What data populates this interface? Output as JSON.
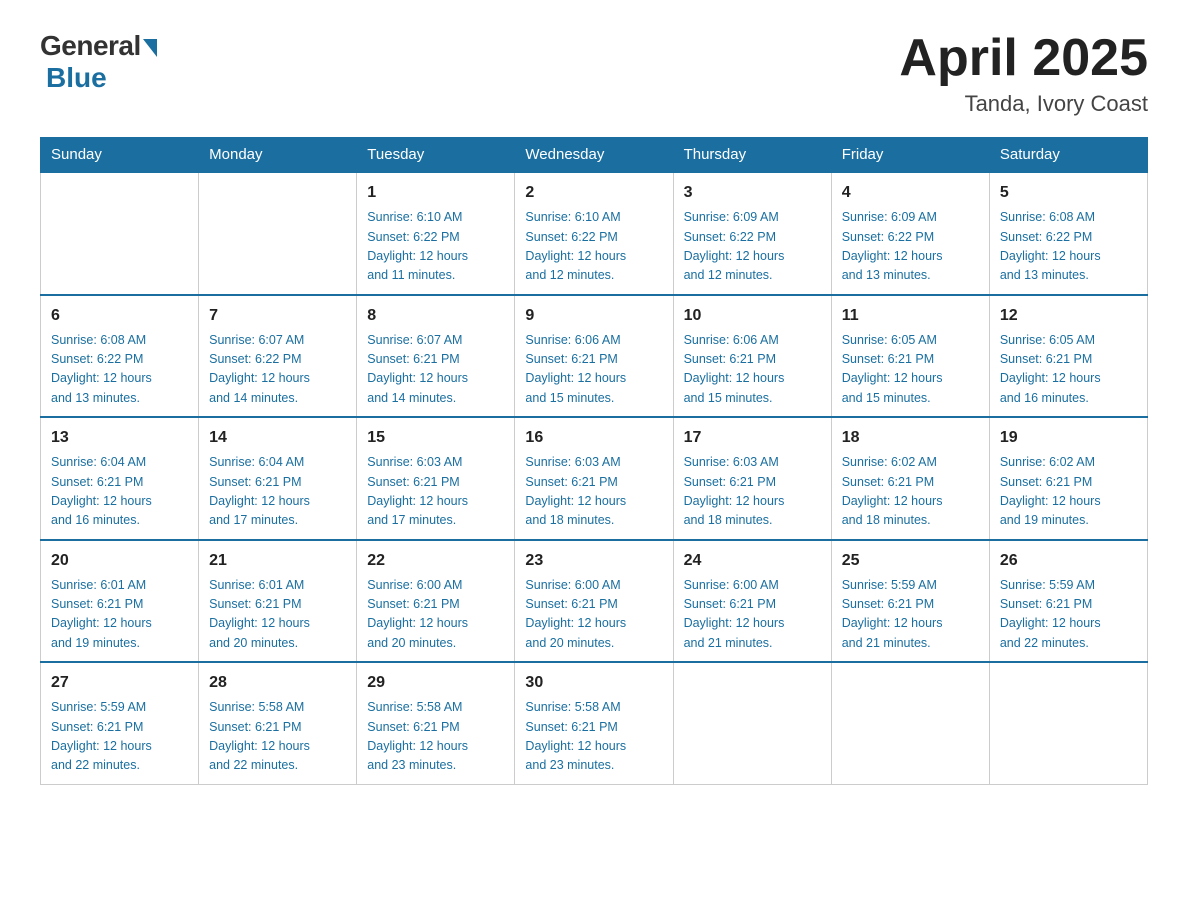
{
  "logo": {
    "general_text": "General",
    "blue_text": "Blue"
  },
  "title": "April 2025",
  "subtitle": "Tanda, Ivory Coast",
  "days_of_week": [
    "Sunday",
    "Monday",
    "Tuesday",
    "Wednesday",
    "Thursday",
    "Friday",
    "Saturday"
  ],
  "weeks": [
    [
      {
        "day": "",
        "info": ""
      },
      {
        "day": "",
        "info": ""
      },
      {
        "day": "1",
        "info": "Sunrise: 6:10 AM\nSunset: 6:22 PM\nDaylight: 12 hours\nand 11 minutes."
      },
      {
        "day": "2",
        "info": "Sunrise: 6:10 AM\nSunset: 6:22 PM\nDaylight: 12 hours\nand 12 minutes."
      },
      {
        "day": "3",
        "info": "Sunrise: 6:09 AM\nSunset: 6:22 PM\nDaylight: 12 hours\nand 12 minutes."
      },
      {
        "day": "4",
        "info": "Sunrise: 6:09 AM\nSunset: 6:22 PM\nDaylight: 12 hours\nand 13 minutes."
      },
      {
        "day": "5",
        "info": "Sunrise: 6:08 AM\nSunset: 6:22 PM\nDaylight: 12 hours\nand 13 minutes."
      }
    ],
    [
      {
        "day": "6",
        "info": "Sunrise: 6:08 AM\nSunset: 6:22 PM\nDaylight: 12 hours\nand 13 minutes."
      },
      {
        "day": "7",
        "info": "Sunrise: 6:07 AM\nSunset: 6:22 PM\nDaylight: 12 hours\nand 14 minutes."
      },
      {
        "day": "8",
        "info": "Sunrise: 6:07 AM\nSunset: 6:21 PM\nDaylight: 12 hours\nand 14 minutes."
      },
      {
        "day": "9",
        "info": "Sunrise: 6:06 AM\nSunset: 6:21 PM\nDaylight: 12 hours\nand 15 minutes."
      },
      {
        "day": "10",
        "info": "Sunrise: 6:06 AM\nSunset: 6:21 PM\nDaylight: 12 hours\nand 15 minutes."
      },
      {
        "day": "11",
        "info": "Sunrise: 6:05 AM\nSunset: 6:21 PM\nDaylight: 12 hours\nand 15 minutes."
      },
      {
        "day": "12",
        "info": "Sunrise: 6:05 AM\nSunset: 6:21 PM\nDaylight: 12 hours\nand 16 minutes."
      }
    ],
    [
      {
        "day": "13",
        "info": "Sunrise: 6:04 AM\nSunset: 6:21 PM\nDaylight: 12 hours\nand 16 minutes."
      },
      {
        "day": "14",
        "info": "Sunrise: 6:04 AM\nSunset: 6:21 PM\nDaylight: 12 hours\nand 17 minutes."
      },
      {
        "day": "15",
        "info": "Sunrise: 6:03 AM\nSunset: 6:21 PM\nDaylight: 12 hours\nand 17 minutes."
      },
      {
        "day": "16",
        "info": "Sunrise: 6:03 AM\nSunset: 6:21 PM\nDaylight: 12 hours\nand 18 minutes."
      },
      {
        "day": "17",
        "info": "Sunrise: 6:03 AM\nSunset: 6:21 PM\nDaylight: 12 hours\nand 18 minutes."
      },
      {
        "day": "18",
        "info": "Sunrise: 6:02 AM\nSunset: 6:21 PM\nDaylight: 12 hours\nand 18 minutes."
      },
      {
        "day": "19",
        "info": "Sunrise: 6:02 AM\nSunset: 6:21 PM\nDaylight: 12 hours\nand 19 minutes."
      }
    ],
    [
      {
        "day": "20",
        "info": "Sunrise: 6:01 AM\nSunset: 6:21 PM\nDaylight: 12 hours\nand 19 minutes."
      },
      {
        "day": "21",
        "info": "Sunrise: 6:01 AM\nSunset: 6:21 PM\nDaylight: 12 hours\nand 20 minutes."
      },
      {
        "day": "22",
        "info": "Sunrise: 6:00 AM\nSunset: 6:21 PM\nDaylight: 12 hours\nand 20 minutes."
      },
      {
        "day": "23",
        "info": "Sunrise: 6:00 AM\nSunset: 6:21 PM\nDaylight: 12 hours\nand 20 minutes."
      },
      {
        "day": "24",
        "info": "Sunrise: 6:00 AM\nSunset: 6:21 PM\nDaylight: 12 hours\nand 21 minutes."
      },
      {
        "day": "25",
        "info": "Sunrise: 5:59 AM\nSunset: 6:21 PM\nDaylight: 12 hours\nand 21 minutes."
      },
      {
        "day": "26",
        "info": "Sunrise: 5:59 AM\nSunset: 6:21 PM\nDaylight: 12 hours\nand 22 minutes."
      }
    ],
    [
      {
        "day": "27",
        "info": "Sunrise: 5:59 AM\nSunset: 6:21 PM\nDaylight: 12 hours\nand 22 minutes."
      },
      {
        "day": "28",
        "info": "Sunrise: 5:58 AM\nSunset: 6:21 PM\nDaylight: 12 hours\nand 22 minutes."
      },
      {
        "day": "29",
        "info": "Sunrise: 5:58 AM\nSunset: 6:21 PM\nDaylight: 12 hours\nand 23 minutes."
      },
      {
        "day": "30",
        "info": "Sunrise: 5:58 AM\nSunset: 6:21 PM\nDaylight: 12 hours\nand 23 minutes."
      },
      {
        "day": "",
        "info": ""
      },
      {
        "day": "",
        "info": ""
      },
      {
        "day": "",
        "info": ""
      }
    ]
  ]
}
